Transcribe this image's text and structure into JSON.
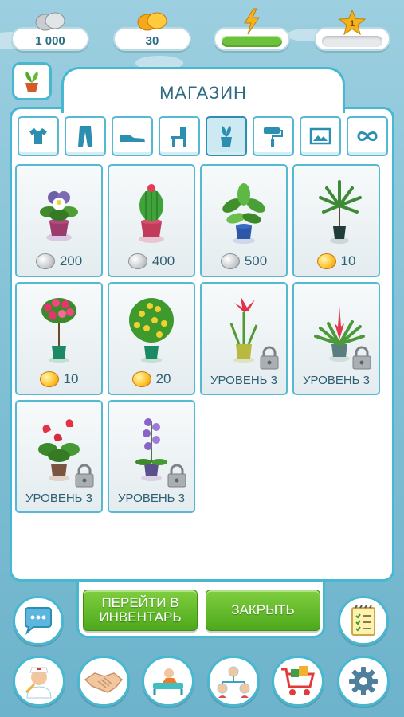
{
  "resources": {
    "silver": "1 000",
    "gold": "30",
    "energy_fill": 1.0,
    "level": "1",
    "xp_fill": 0.0
  },
  "shop": {
    "title": "МАГАЗИН",
    "categories": [
      {
        "icon": "shirt-icon"
      },
      {
        "icon": "pants-icon"
      },
      {
        "icon": "shoe-icon"
      },
      {
        "icon": "chair-icon"
      },
      {
        "icon": "plant-icon",
        "active": true
      },
      {
        "icon": "paint-roller-icon"
      },
      {
        "icon": "picture-icon"
      },
      {
        "icon": "infinity-icon"
      }
    ],
    "items": [
      {
        "name": "violet",
        "currency": "silver",
        "price": "200"
      },
      {
        "name": "cactus",
        "currency": "silver",
        "price": "400"
      },
      {
        "name": "dieffenbachia",
        "currency": "silver",
        "price": "500"
      },
      {
        "name": "palm",
        "currency": "gold",
        "price": "10"
      },
      {
        "name": "rose-tree",
        "currency": "gold",
        "price": "10"
      },
      {
        "name": "lemon-tree",
        "currency": "gold",
        "price": "20"
      },
      {
        "name": "amaryllis",
        "locked": true,
        "level": "УРОВЕНЬ 3"
      },
      {
        "name": "bromeliad",
        "locked": true,
        "level": "УРОВЕНЬ 3"
      },
      {
        "name": "anthurium",
        "locked": true,
        "level": "УРОВЕНЬ 3"
      },
      {
        "name": "orchid",
        "locked": true,
        "level": "УРОВЕНЬ 3"
      }
    ]
  },
  "actions": {
    "inventory": "ПЕРЕЙТИ В ИНВЕНТАРЬ",
    "close": "ЗАКРЫТЬ"
  },
  "colors": {
    "accent": "#48b7d2",
    "button_green": "#5db327",
    "text": "#2f6a82"
  }
}
